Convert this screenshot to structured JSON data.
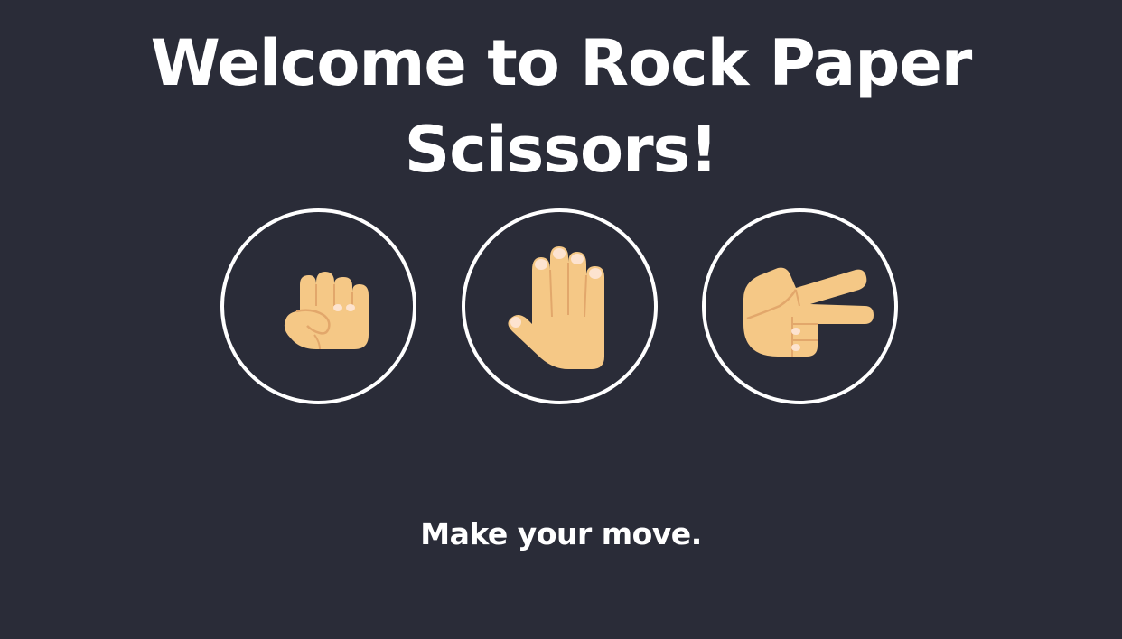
{
  "title": "Welcome to Rock Paper Scissors!",
  "choices": [
    {
      "id": "rock",
      "icon": "raised-fist-icon"
    },
    {
      "id": "paper",
      "icon": "raised-hand-icon"
    },
    {
      "id": "scissors",
      "icon": "victory-hand-icon"
    }
  ],
  "prompt": "Make your move.",
  "colors": {
    "background": "#2a2c38",
    "text": "#ffffff",
    "ring": "#ffffff",
    "skin": "#f5c886",
    "skin_shadow": "#e2a76b",
    "nail": "#fde3cf"
  }
}
